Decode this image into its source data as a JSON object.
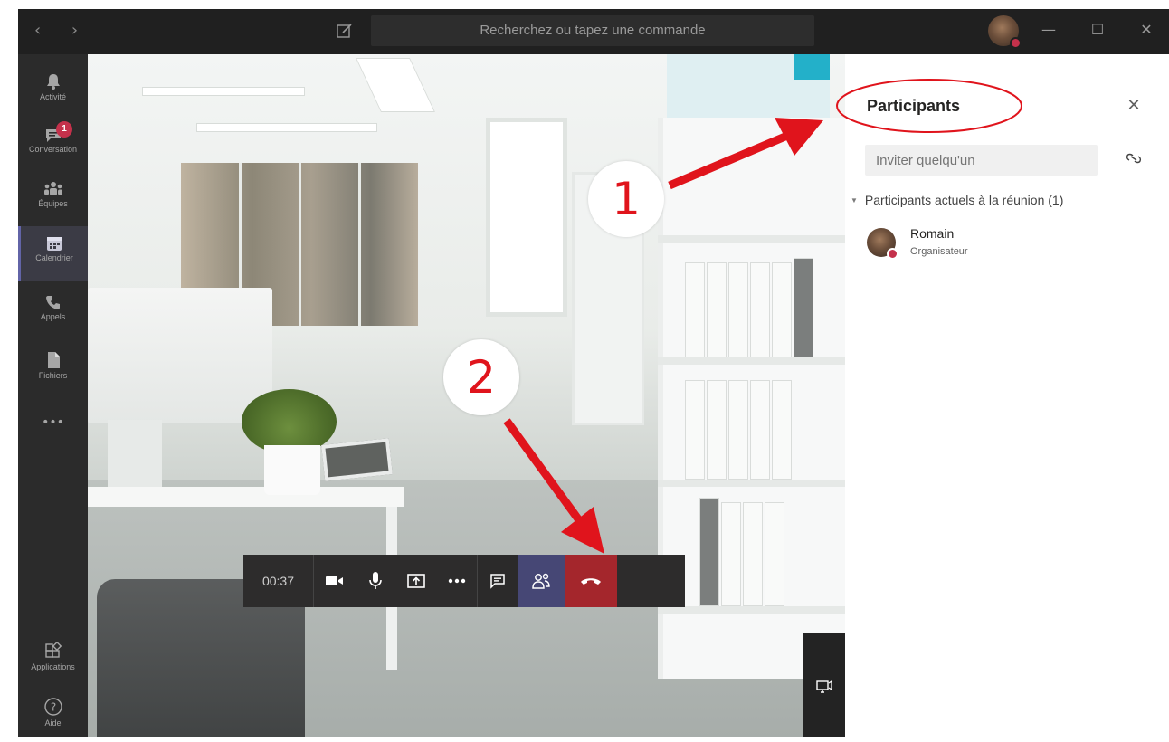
{
  "titlebar": {
    "nav_arrows": "‹  ›",
    "search_placeholder": "Recherchez ou tapez une commande",
    "minimize": "—",
    "maximize": "☐",
    "close": "✕"
  },
  "rail": {
    "items": [
      {
        "label": "Activité",
        "icon": "bell-icon"
      },
      {
        "label": "Conversation",
        "icon": "chat-icon",
        "badge": "1"
      },
      {
        "label": "Équipes",
        "icon": "teams-icon"
      },
      {
        "label": "Calendrier",
        "icon": "calendar-icon",
        "active": true
      },
      {
        "label": "Appels",
        "icon": "phone-icon"
      },
      {
        "label": "Fichiers",
        "icon": "files-icon"
      },
      {
        "label": "•••",
        "icon": "more-icon"
      }
    ],
    "bottom": [
      {
        "label": "Applications",
        "icon": "apps-icon"
      },
      {
        "label": "Aide",
        "icon": "help-icon"
      }
    ]
  },
  "call": {
    "timer": "00:37"
  },
  "annotations": {
    "step1": "1",
    "step2": "2"
  },
  "panel": {
    "title": "Participants",
    "close": "✕",
    "invite_placeholder": "Inviter quelqu'un",
    "section_label": "Participants actuels à la réunion (1)",
    "participants": [
      {
        "name": "Romain",
        "role": "Organisateur"
      }
    ]
  },
  "colors": {
    "accent": "#6264a7",
    "hangup": "#a4262c",
    "badge": "#c4314b",
    "annotation": "#e0141c"
  }
}
